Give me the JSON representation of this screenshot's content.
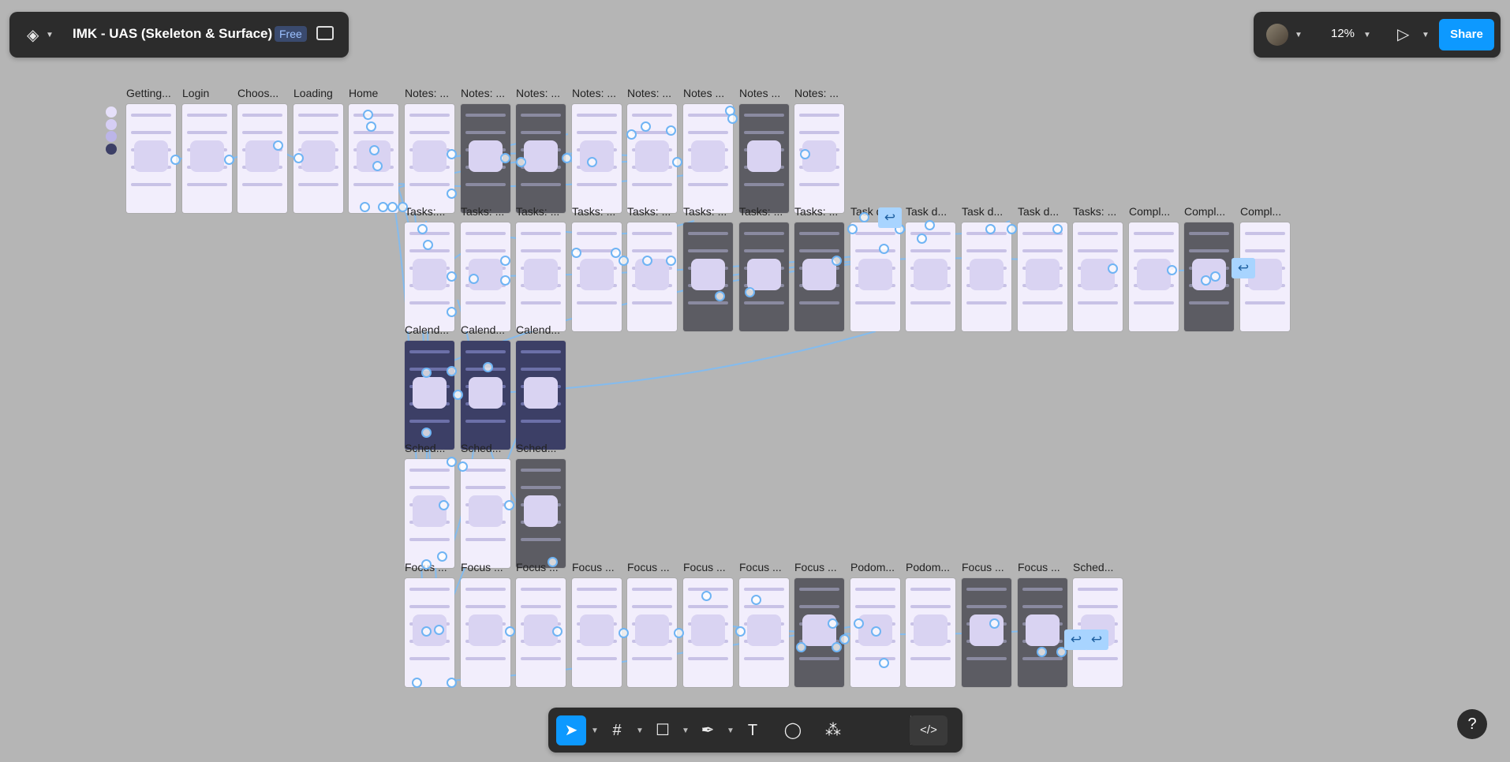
{
  "topbar": {
    "file_name": "IMK - UAS (Skeleton & Surface)",
    "plan_badge": "Free",
    "zoom": "12%",
    "share_label": "Share",
    "menu_icon": "figma-logo-icon",
    "sidebar_icon": "panel-toggle-icon",
    "present_icon": "play-icon"
  },
  "toolbar": {
    "tools": [
      "move",
      "frame",
      "rectangle",
      "pen",
      "text",
      "comment",
      "actions"
    ],
    "active_tool": "move",
    "dev_mode_icon": "code-icon"
  },
  "help_label": "?",
  "colors": {
    "accent": "#0d99ff",
    "canvas": "#b5b5b5",
    "link": "#6fb4f4",
    "frame": "#f2eefc"
  },
  "frames": {
    "row1": [
      "Getting...",
      "Login",
      "Choos...",
      "Loading",
      "Home",
      "Notes: ...",
      "Notes: ...",
      "Notes: ...",
      "Notes: ...",
      "Notes: ...",
      "Notes ...",
      "Notes ...",
      "Notes: ..."
    ],
    "row2": [
      "Tasks:...",
      "Tasks: ...",
      "Tasks: ...",
      "Tasks: ...",
      "Tasks: ...",
      "Tasks: ...",
      "Tasks: ...",
      "Tasks: ...",
      "Task d...",
      "Task d...",
      "Task d...",
      "Task d...",
      "Tasks: ...",
      "Compl...",
      "Compl...",
      "Compl..."
    ],
    "row3": [
      "Calend...",
      "Calend...",
      "Calend..."
    ],
    "row4": [
      "Sched...",
      "Sched...",
      "Sched..."
    ],
    "row5": [
      "Focus ...",
      "Focus ...",
      "Focus ...",
      "Focus ...",
      "Focus ...",
      "Focus ...",
      "Focus ...",
      "Focus ...",
      "Podom...",
      "Podom...",
      "Focus ...",
      "Focus ...",
      "Sched..."
    ]
  }
}
